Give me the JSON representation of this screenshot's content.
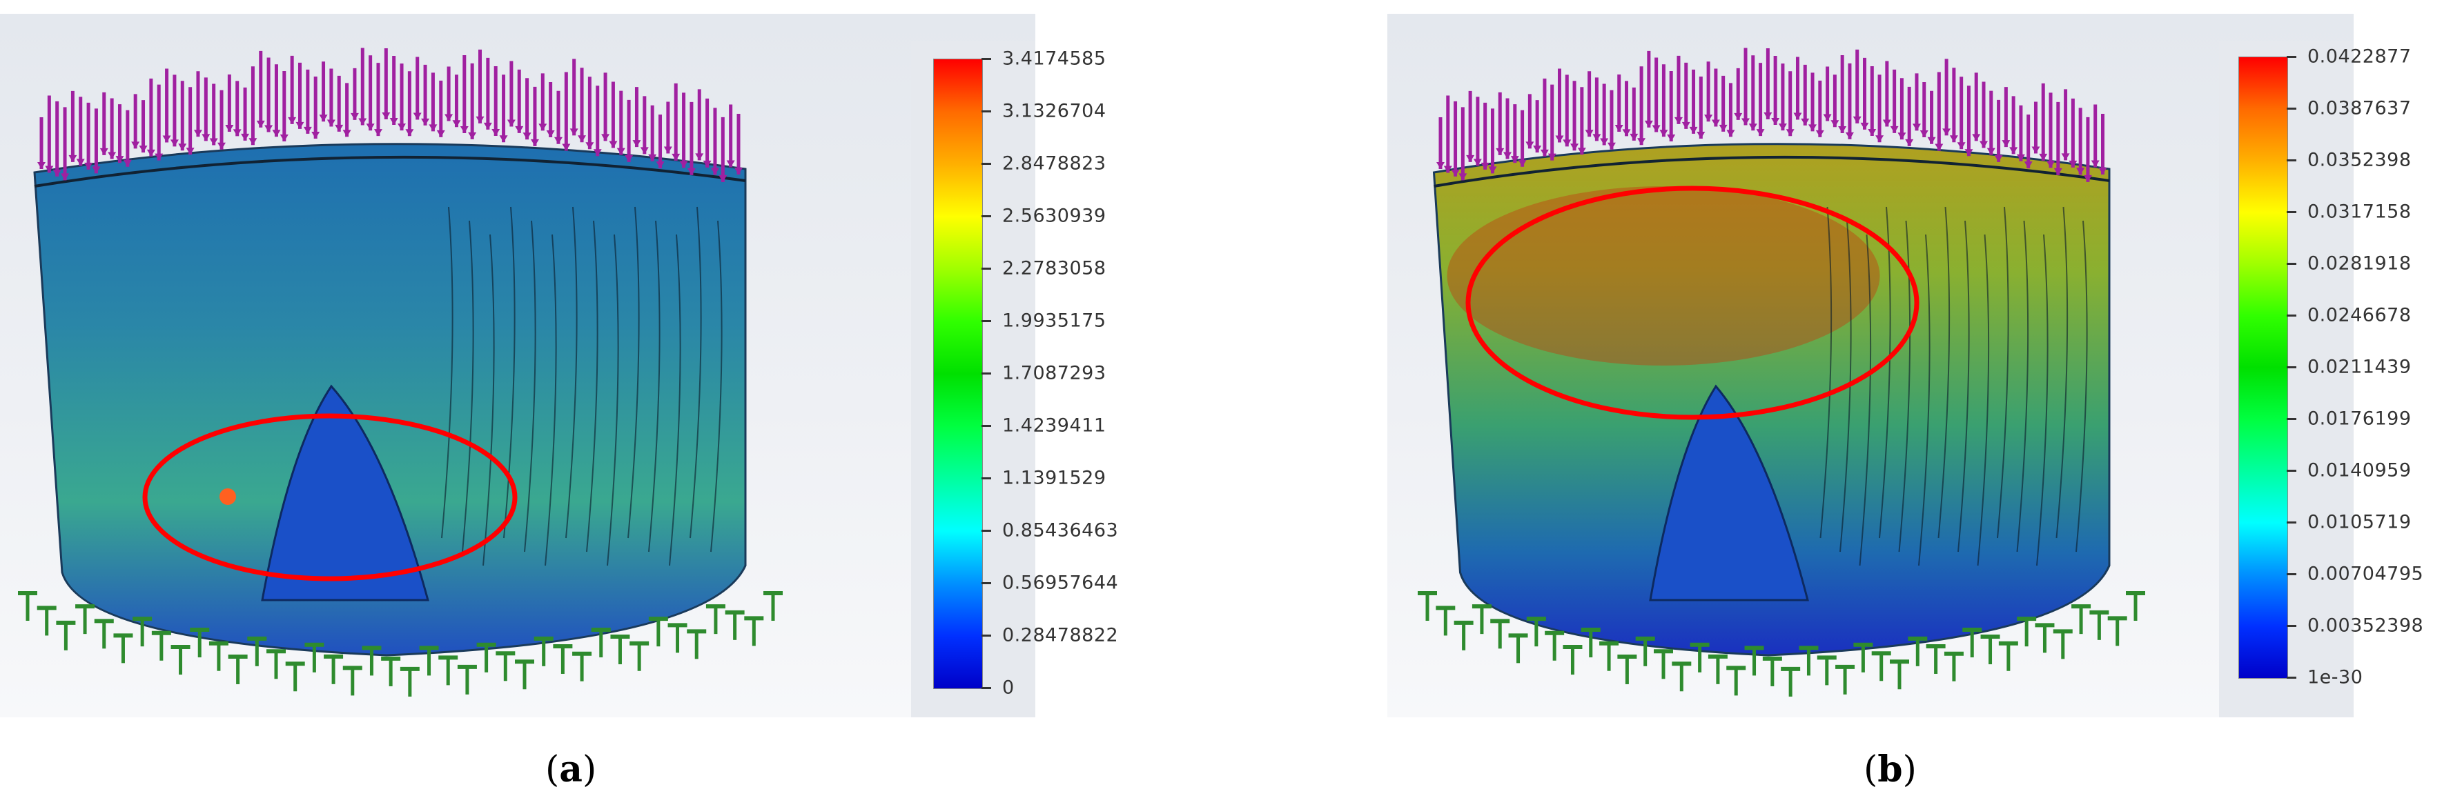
{
  "panels": [
    {
      "id": "a",
      "caption_open": "(",
      "caption_letter": "a",
      "caption_close": ")",
      "legend": {
        "labels": [
          "3.4174585",
          "3.1326704",
          "2.8478823",
          "2.5630939",
          "2.2783058",
          "1.9935175",
          "1.7087293",
          "1.4239411",
          "1.1391529",
          "0.85436463",
          "0.56957644",
          "0.28478822",
          "0"
        ],
        "colors": [
          "#ff0000",
          "#ff6a00",
          "#ffb000",
          "#ffff00",
          "#a0ff00",
          "#30ff00",
          "#00e000",
          "#00ff40",
          "#00ffa0",
          "#00ffff",
          "#0090ff",
          "#0030ff",
          "#0000c8"
        ]
      },
      "highlight_color": "#ff0000"
    },
    {
      "id": "b",
      "caption_open": "(",
      "caption_letter": "b",
      "caption_close": ")",
      "legend": {
        "labels": [
          "0.0422877",
          "0.0387637",
          "0.0352398",
          "0.0317158",
          "0.0281918",
          "0.0246678",
          "0.0211439",
          "0.0176199",
          "0.0140959",
          "0.0105719",
          "0.00704795",
          "0.00352398",
          "1e-30"
        ],
        "colors": [
          "#ff0000",
          "#ff6a00",
          "#ffb000",
          "#ffff00",
          "#a0ff00",
          "#30ff00",
          "#00e000",
          "#00ff40",
          "#00ffa0",
          "#00ffff",
          "#0090ff",
          "#0030ff",
          "#0000c8"
        ]
      },
      "highlight_color": "#ff0000"
    }
  ],
  "load_arrow_color": "#a020a0",
  "fixture_color": "#2e8b2e"
}
